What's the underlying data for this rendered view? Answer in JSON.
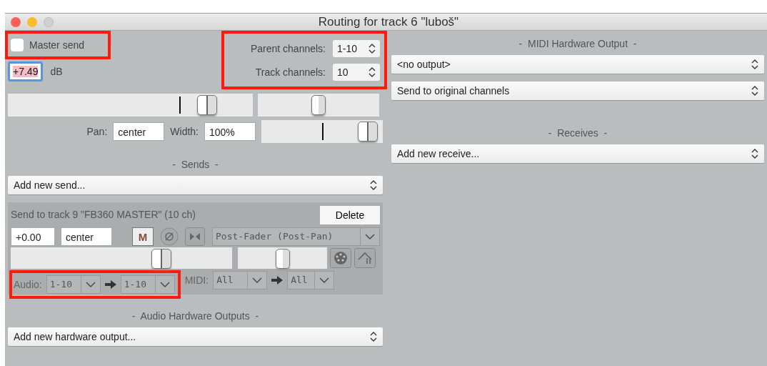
{
  "window": {
    "title": "Routing for track 6 \"luboš\""
  },
  "master_send": {
    "label": "Master send",
    "checked": false
  },
  "volume": {
    "value": "+7.49",
    "unit": "dB"
  },
  "channels": [
    {
      "label": "Parent channels:",
      "value": "1-10"
    },
    {
      "label": "Track channels:",
      "value": "10"
    }
  ],
  "volume_fader": {
    "level": 0.84
  },
  "pan_fader": {
    "level": 0.5
  },
  "pan": {
    "label": "Pan:",
    "value": "center"
  },
  "width": {
    "label": "Width:",
    "value": "100%"
  },
  "width_fader": {
    "level": 0.95
  },
  "sends": {
    "heading": "-  Sends  -",
    "add": "Add new send..."
  },
  "send": {
    "title": "Send to track 9 \"FB360 MASTER\" (10 ch)",
    "delete": "Delete",
    "volume": "+0.00",
    "pan": "center",
    "mute": "M",
    "mode": "Post-Fader (Post-Pan)",
    "volume_fader": {
      "level": 0.7
    },
    "pan_fader": {
      "level": 0.5
    },
    "audio_label": "Audio:",
    "audio_src": "1-10",
    "audio_dst": "1-10",
    "midi_label": "MIDI:",
    "midi_src": "All",
    "midi_dst": "All"
  },
  "hardware_outputs": {
    "heading": "-  Audio Hardware Outputs  -",
    "add": "Add new hardware output..."
  },
  "midi_output": {
    "heading": "-  MIDI Hardware Output  -",
    "device": "<no output>",
    "mapping": "Send to original channels"
  },
  "receives": {
    "heading": "-  Receives  -",
    "add": "Add new receive..."
  }
}
